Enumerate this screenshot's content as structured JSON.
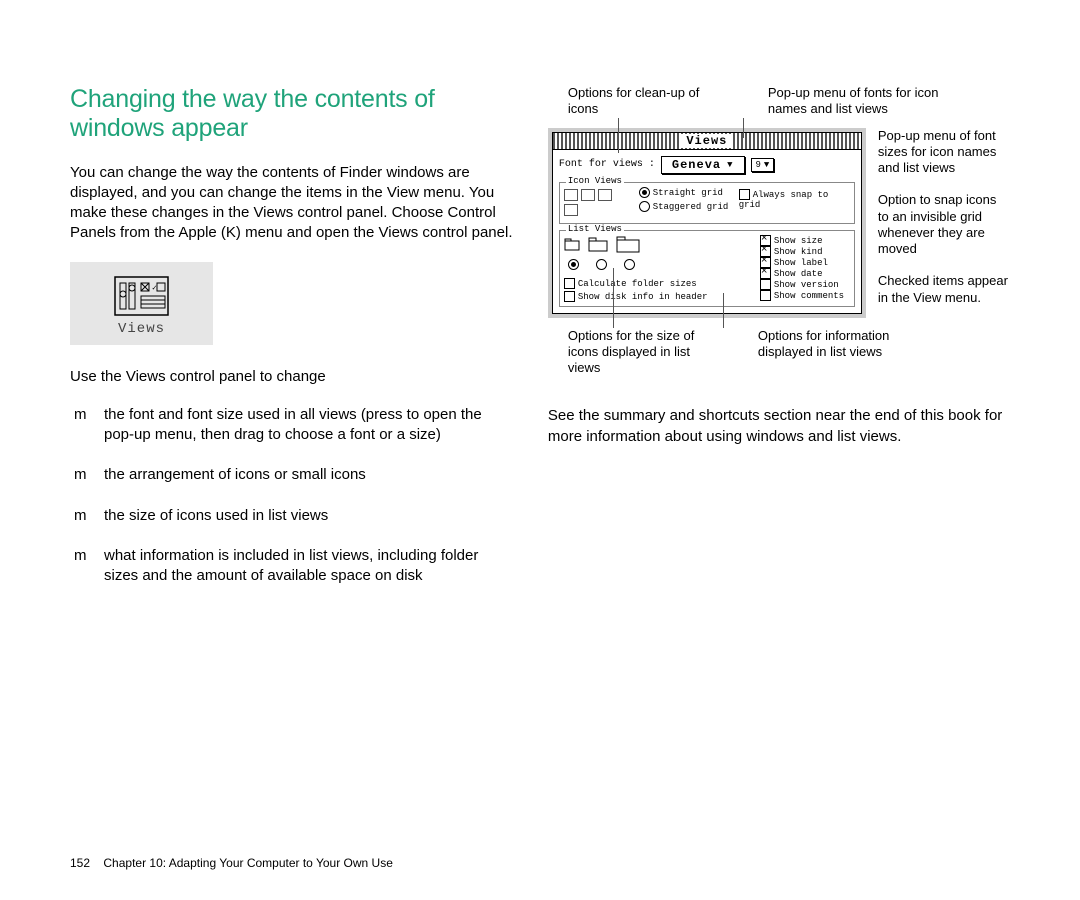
{
  "heading": "Changing the way the contents of windows appear",
  "intro": "You can change the way the contents of Finder windows are displayed, and you can change the items in the View menu. You make these changes in the Views control panel. Choose Control Panels from the Apple (K) menu and open the Views control panel.",
  "views_icon_label": "Views",
  "use_intro": "Use the Views control panel to change",
  "bullets": [
    "the font and font size used in all views (press to open the pop-up menu, then drag to choose a font or a size)",
    "the arrangement of icons or small icons",
    "the size of icons used in list views",
    "what information is included in list views, including folder sizes and the amount of available space on disk"
  ],
  "footer_page": "152",
  "footer_text": "Chapter 10:  Adapting Your Computer to Your Own Use",
  "ann_top": {
    "a1": "Options for clean-up of icons",
    "a2": "Pop-up menu of fonts for icon names and list views"
  },
  "ann_right": {
    "r1": "Pop-up menu of font sizes for icon names and list views",
    "r2": "Option to snap icons to an invisible grid whenever they are moved",
    "r3": "Checked items appear in the View menu."
  },
  "ann_bottom": {
    "b1": "Options for the size of icons displayed in list views",
    "b2": "Options for information displayed in list views"
  },
  "screenshot": {
    "title": "Views",
    "font_label": "Font for views :",
    "font_value": "Geneva",
    "size_value": "9",
    "iconviews_leg": "Icon Views",
    "straight_grid": "Straight grid",
    "staggered_grid": "Staggered grid",
    "snap": "Always snap to grid",
    "listviews_leg": "List Views",
    "calc": "Calculate folder sizes",
    "diskinfo": "Show disk info in header",
    "show_size": "Show size",
    "show_kind": "Show kind",
    "show_label": "Show label",
    "show_date": "Show date",
    "show_version": "Show version",
    "show_comments": "Show comments"
  },
  "closing": "See the summary and shortcuts section near the end of this book for more information about using windows and list views."
}
